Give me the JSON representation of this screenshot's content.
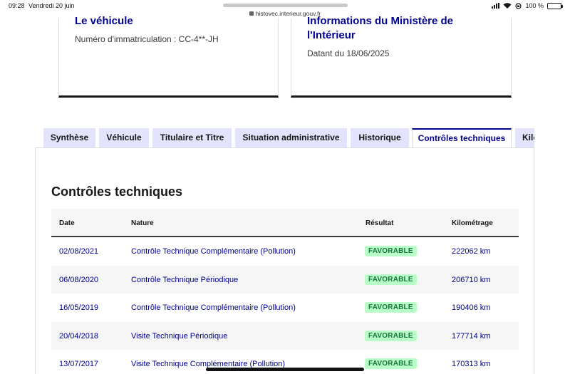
{
  "status_bar": {
    "time": "09:28",
    "date": "Vendredi 20 juin",
    "url": "histovec.interieur.gouv.fr",
    "battery": "100 %"
  },
  "vehicle_card": {
    "title": "Le véhicule",
    "plate_text": "Numéro d'immatriculation : CC-4**-JH"
  },
  "ministry_card": {
    "title_line1": "Informations du Ministère de",
    "title_line2": "l'Intérieur",
    "date_text": "Datant du 18/06/2025"
  },
  "tabs": [
    {
      "label": "Synthèse",
      "active": false
    },
    {
      "label": "Véhicule",
      "active": false
    },
    {
      "label": "Titulaire et Titre",
      "active": false
    },
    {
      "label": "Situation administrative",
      "active": false
    },
    {
      "label": "Historique",
      "active": false
    },
    {
      "label": "Contrôles techniques",
      "active": true
    },
    {
      "label": "Kilo",
      "active": false
    }
  ],
  "section_title": "Contrôles techniques",
  "table": {
    "headers": {
      "date": "Date",
      "nature": "Nature",
      "result": "Résultat",
      "km": "Kilométrage"
    },
    "rows": [
      {
        "date": "02/08/2021",
        "nature": "Contrôle Technique Complémentaire (Pollution)",
        "result": "FAVORABLE",
        "km": "222062 km"
      },
      {
        "date": "06/08/2020",
        "nature": "Contrôle Technique Périodique",
        "result": "FAVORABLE",
        "km": "206710 km"
      },
      {
        "date": "16/05/2019",
        "nature": "Contrôle Technique Complémentaire (Pollution)",
        "result": "FAVORABLE",
        "km": "190406 km"
      },
      {
        "date": "20/04/2018",
        "nature": "Visite Technique Périodique",
        "result": "FAVORABLE",
        "km": "177714 km"
      },
      {
        "date": "13/07/2017",
        "nature": "Visite Technique Complémentaire (Pollution)",
        "result": "FAVORABLE",
        "km": "170313 km"
      }
    ]
  },
  "colors": {
    "primary_blue": "#000091",
    "tab_bg": "#e3e3fd",
    "badge_bg": "#b8fec9",
    "badge_text": "#18753c"
  }
}
